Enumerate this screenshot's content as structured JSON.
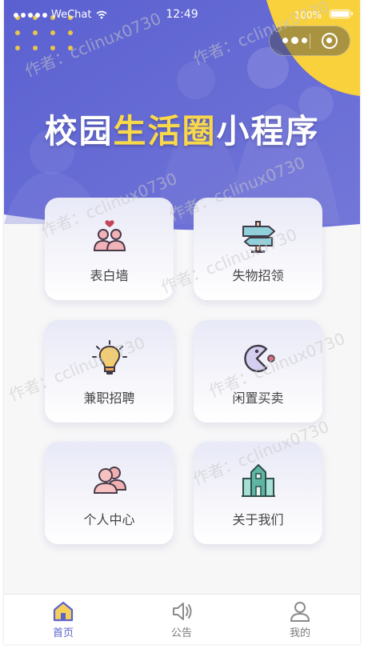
{
  "status_bar": {
    "carrier": "WeChat",
    "time": "12:49",
    "battery": "100%",
    "battery_level": 1.0
  },
  "hero": {
    "title_part1": "校园",
    "title_highlight": "生活圈",
    "title_part2": "小程序",
    "colors": {
      "overlay": "#6a6ed6",
      "accent": "#f9d84a"
    }
  },
  "watermark": "作者：cclinux0730",
  "menu": [
    {
      "label": "表白墙",
      "icon": "couple-heart-icon"
    },
    {
      "label": "失物招领",
      "icon": "signpost-icon"
    },
    {
      "label": "兼职招聘",
      "icon": "lightbulb-icon"
    },
    {
      "label": "闲置买卖",
      "icon": "pacman-icon"
    },
    {
      "label": "个人中心",
      "icon": "users-icon"
    },
    {
      "label": "关于我们",
      "icon": "building-icon"
    }
  ],
  "tabbar": [
    {
      "label": "首页",
      "icon": "home-icon",
      "active": true
    },
    {
      "label": "公告",
      "icon": "speaker-icon",
      "active": false
    },
    {
      "label": "我的",
      "icon": "user-icon",
      "active": false
    }
  ]
}
